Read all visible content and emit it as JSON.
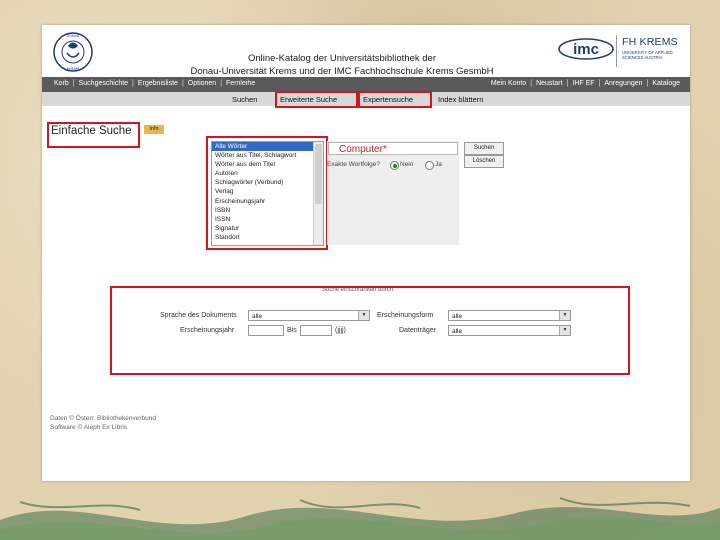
{
  "header": {
    "title_line1": "Online-Katalog der Universitätsbibliothek der",
    "title_line2": "Donau-Universität Krems und der IMC Fachhochschule Krems GesmbH",
    "imc_logo_text": "imc",
    "fh_logo_text": "FH KREMS",
    "fh_logo_subtext": "UNIVERSITY OF APPLIED SCIENCES AUSTRIA"
  },
  "nav_left": [
    "Korb",
    "Suchgeschichte",
    "Ergebnisliste",
    "Optionen",
    "Fernleihe"
  ],
  "nav_right": [
    "Mein Konto",
    "Neustart",
    "IHF EF",
    "Anregungen",
    "Kataloge"
  ],
  "subnav": {
    "search": "Suchen",
    "advanced": "Erweiterte Suche",
    "expert": "Expertensuche",
    "browse": "Index blättern"
  },
  "simple_search": {
    "title": "Einfache Suche",
    "info": "Info"
  },
  "field_list": [
    "Alle Wörter",
    "Wörter aus Titel, Schlagwort",
    "Wörter aus dem Titel",
    "Autoren",
    "Schlagwörter (Verbund)",
    "Verlag",
    "Erscheinungsjahr",
    "ISBN",
    "ISSN",
    "Signatur",
    "Standort"
  ],
  "query": {
    "value": "Computer*",
    "exact_label": "Exakte Wortfolge?",
    "option_no": "Nein",
    "option_yes": "Ja",
    "search_button": "Suchen",
    "clear_button": "Löschen"
  },
  "filters": {
    "heading": "Suche einschränken durch:",
    "doc_type_label": "Sprache des Dokuments",
    "doc_type_value": "alle",
    "form_label": "Erscheinungsform",
    "form_value": "alle",
    "year_label": "Erscheinungsjahr",
    "bis_label": "Bis",
    "format_label": "(jjjj)",
    "holding_label": "Datenträger",
    "holding_value": "alle"
  },
  "footer": {
    "line1": "Daten © Österr. Bibliothekenverbund",
    "line2": "Software © Aleph Ex Libris"
  },
  "colors": {
    "highlight": "#d6141d",
    "navbar": "#5a5a5a",
    "selected": "#3569c7",
    "query_text": "#cc2222"
  }
}
